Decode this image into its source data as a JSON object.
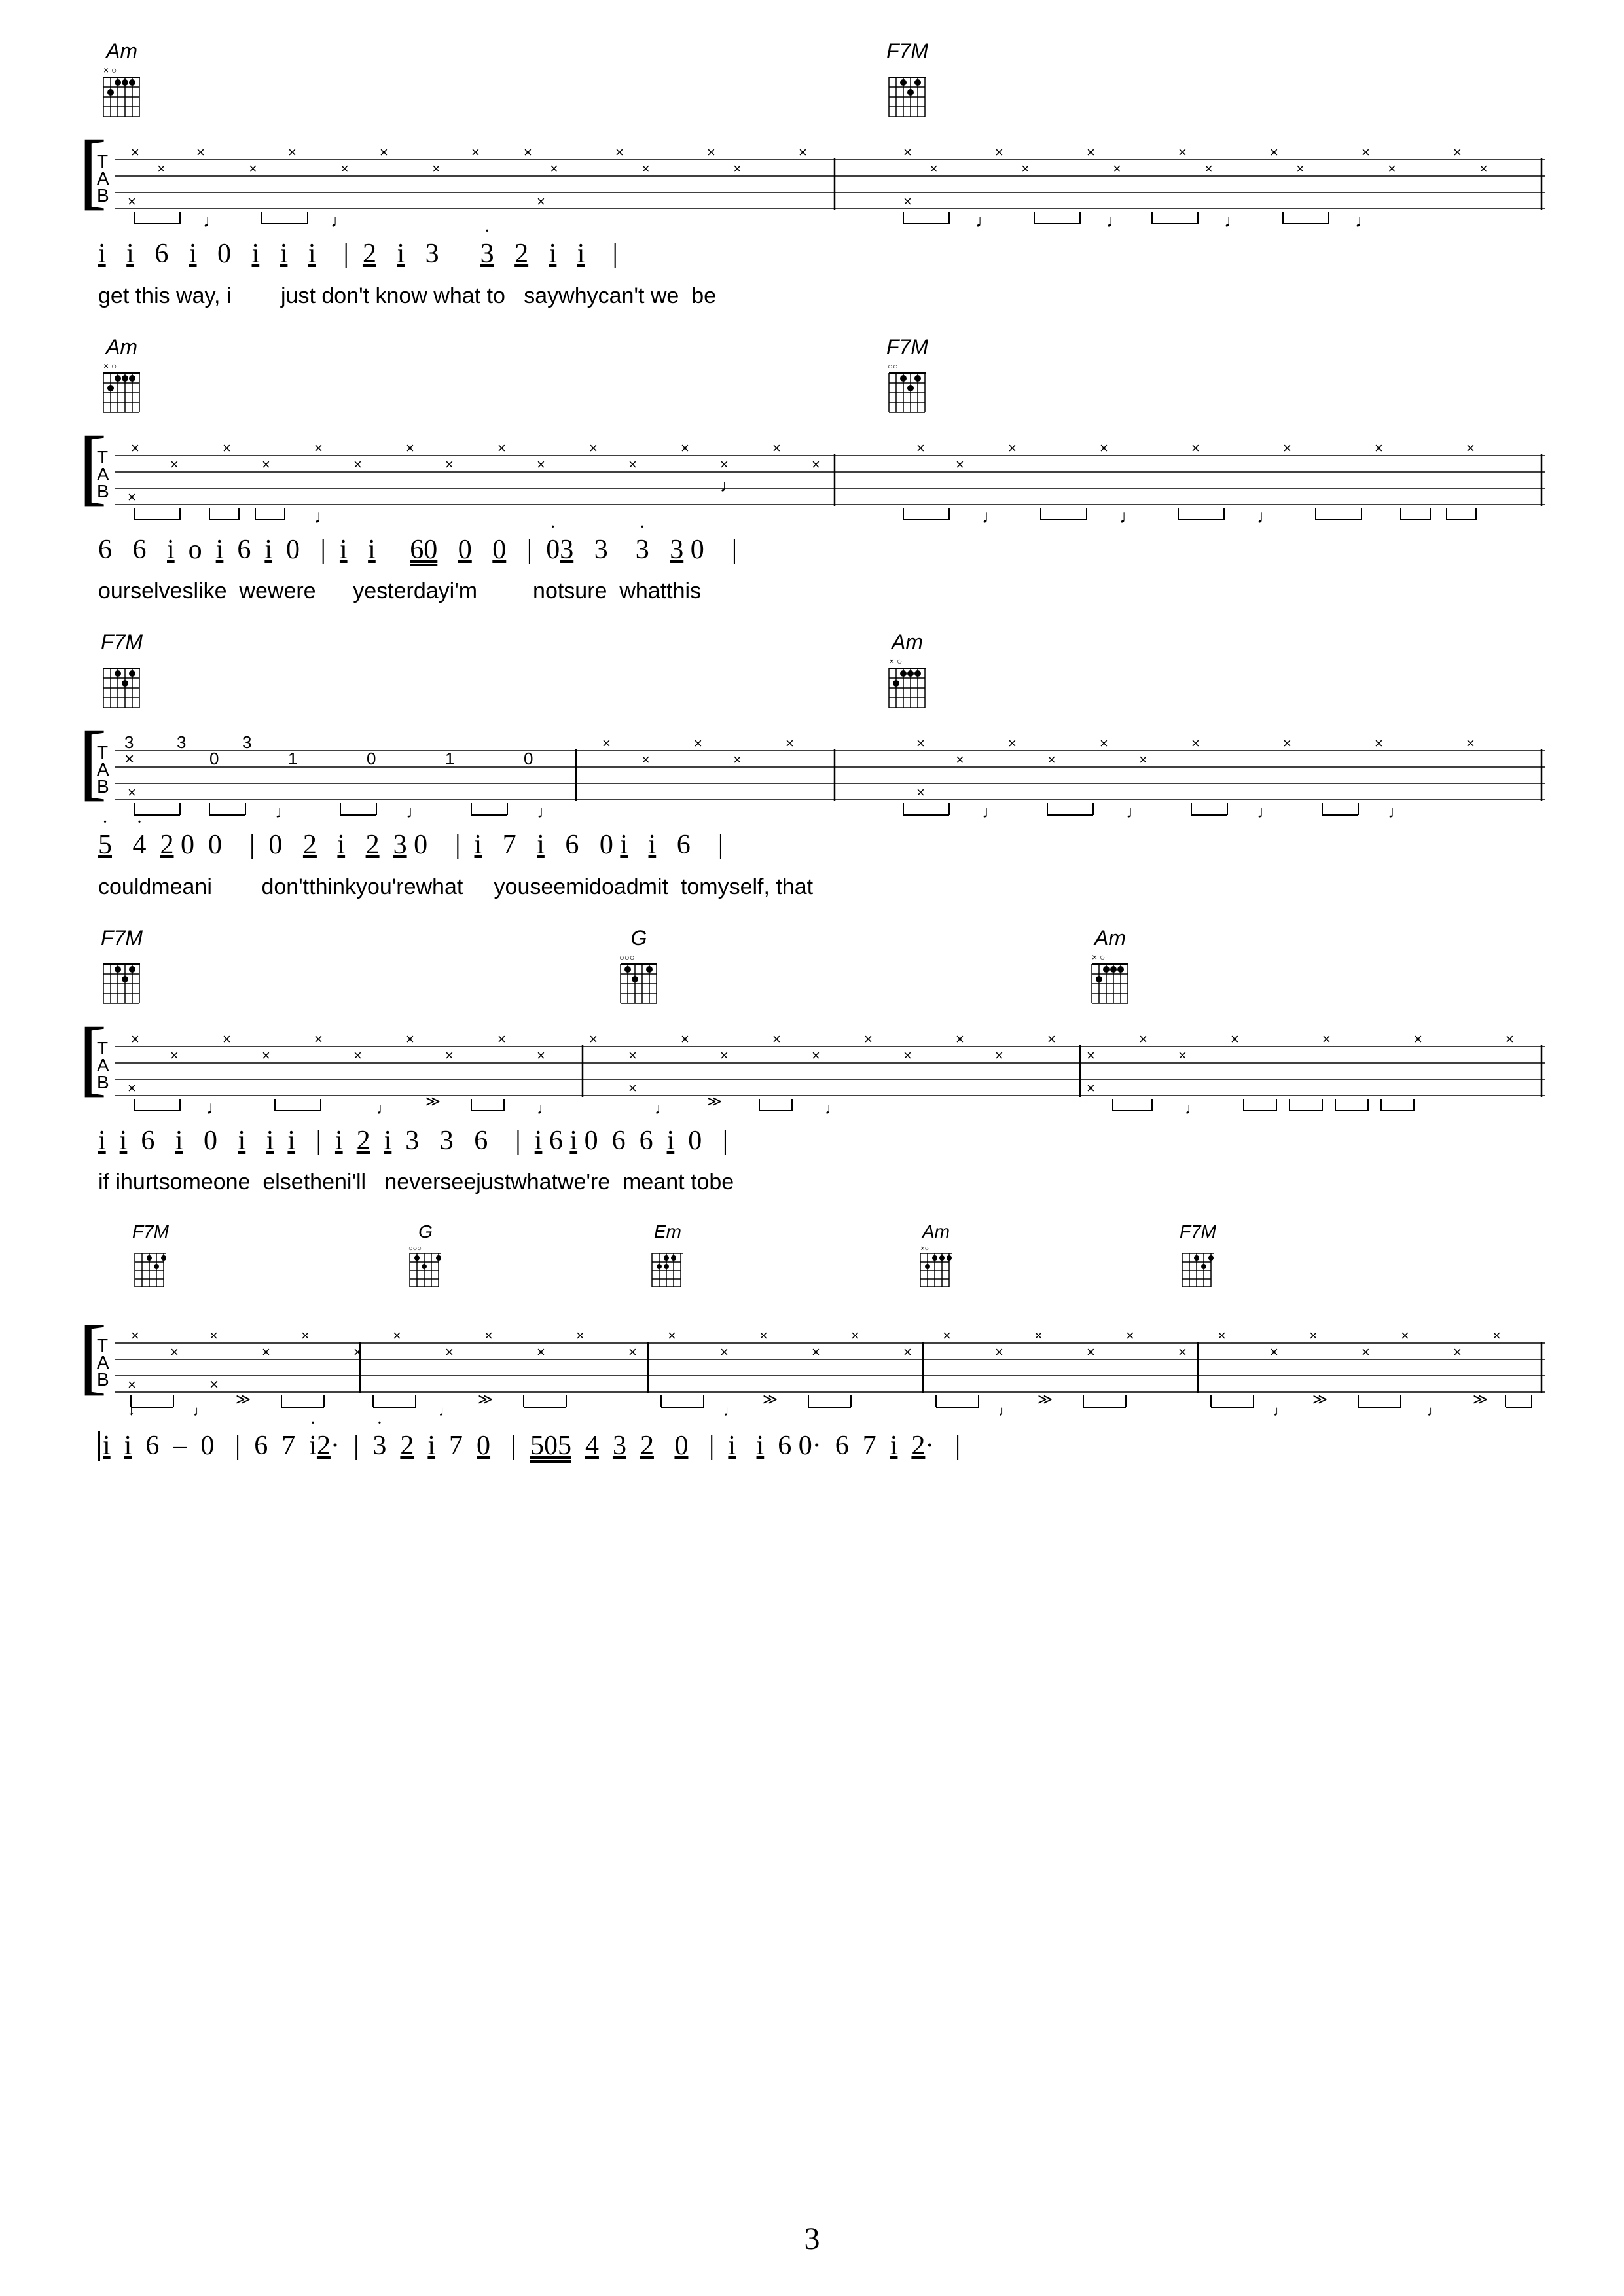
{
  "page": {
    "number": "3",
    "sections": [
      {
        "id": "section1",
        "chords": [
          {
            "name": "Am",
            "position": "left",
            "xPercent": 4
          },
          {
            "name": "F7M",
            "position": "right",
            "xPercent": 52
          }
        ],
        "notation": "i  i  6  i  0  i  i  i  | 2  i  3     3  2  i  i  |",
        "lyrics": "get this way, i        just don't know what to   saywhycan't we  be"
      },
      {
        "id": "section2",
        "chords": [
          {
            "name": "Am",
            "position": "left",
            "xPercent": 4
          },
          {
            "name": "F7M",
            "position": "right",
            "xPercent": 52
          }
        ],
        "notation": "6  6  i o i 6 i 0 | i  i   60  0  0 | 03  3   3  30  |",
        "lyrics": "ourselveslike  wewere      yesterdayi'm         notsure  whatthis"
      },
      {
        "id": "section3",
        "chords": [
          {
            "name": "F7M",
            "position": "left",
            "xPercent": 4
          },
          {
            "name": "Am",
            "position": "right",
            "xPercent": 52
          }
        ],
        "notation": "5  4 20 0  | 0  2  i  2 30  | i  7  i  6  0i  i  6  |",
        "lyrics": "couldmeani     don'tthinkyou'rewhat     youseemidoadmit  tomyself, that"
      },
      {
        "id": "section4",
        "chords": [
          {
            "name": "F7M",
            "position": "left",
            "xPercent": 4
          },
          {
            "name": "G",
            "position": "mid",
            "xPercent": 38
          },
          {
            "name": "Am",
            "position": "right",
            "xPercent": 68
          }
        ],
        "notation": "i i 6  i  0  i  i i | i 2 i 3  3  6 | i6i0 6 6 i 0 |",
        "lyrics": "if ihurtsomeone  elsetheni'll   neverseejustwhatwe're  meant tobe"
      },
      {
        "id": "section5",
        "chords": [
          {
            "name": "F7M",
            "position": "c1",
            "xPercent": 8
          },
          {
            "name": "G",
            "position": "c2",
            "xPercent": 21
          },
          {
            "name": "Em",
            "position": "c3",
            "xPercent": 36
          },
          {
            "name": "Am",
            "position": "c4",
            "xPercent": 52
          },
          {
            "name": "F7M",
            "position": "c5",
            "xPercent": 68
          }
        ],
        "notation": "i i 6 – 0 | 6 7 i 2·  | 3 2 i 7 0 | 505 4 3 2  0 | i  i 60·  6  7  i 2· |",
        "lyrics": ""
      }
    ]
  }
}
